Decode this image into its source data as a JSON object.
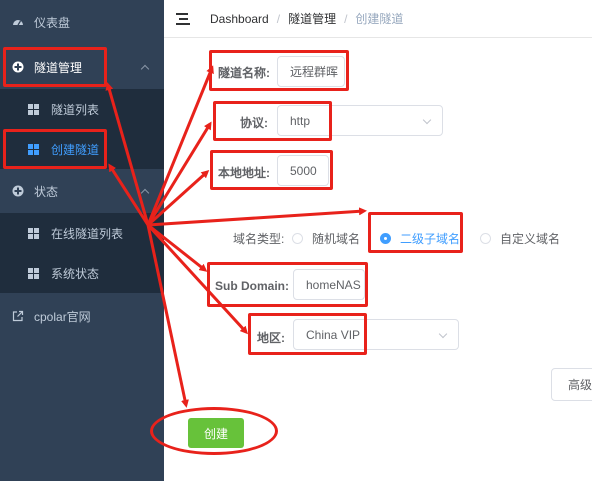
{
  "sidebar": {
    "items": [
      {
        "label": "仪表盘",
        "icon": "dashboard-icon"
      },
      {
        "label": "隧道管理",
        "icon": "plus-circle-icon"
      },
      {
        "label": "隧道列表",
        "icon": "grid-icon"
      },
      {
        "label": "创建隧道",
        "icon": "grid-icon"
      },
      {
        "label": "状态",
        "icon": "plus-circle-icon"
      },
      {
        "label": "在线隧道列表",
        "icon": "grid-icon"
      },
      {
        "label": "系统状态",
        "icon": "grid-icon"
      },
      {
        "label": "cpolar官网",
        "icon": "external-link-icon"
      }
    ],
    "active_color": "#409eff",
    "background": "#304156"
  },
  "breadcrumb": [
    "Dashboard",
    "隧道管理",
    "创建隧道"
  ],
  "form": {
    "name": {
      "label": "隧道名称:",
      "value": "远程群晖"
    },
    "protocol": {
      "label": "协议:",
      "value": "http"
    },
    "local_address": {
      "label": "本地地址:",
      "value": "5000"
    },
    "domain_type": {
      "label": "域名类型:",
      "options": [
        "随机域名",
        "二级子域名",
        "自定义域名"
      ],
      "selected": "二级子域名"
    },
    "subdomain": {
      "label": "Sub Domain:",
      "value": "homeNAS"
    },
    "region": {
      "label": "地区:",
      "value": "China VIP"
    }
  },
  "buttons": {
    "advanced": "高级",
    "create": "创建"
  },
  "colors": {
    "annotation": "#e8221b",
    "create_button": "#67c23a"
  }
}
